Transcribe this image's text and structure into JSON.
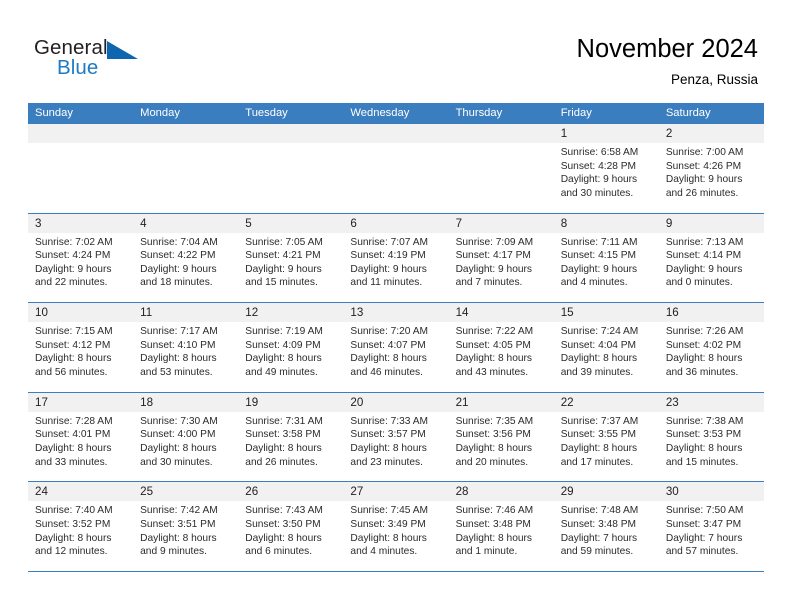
{
  "logo": {
    "word_one": "General",
    "word_two": "Blue",
    "mark": "triangle-mark"
  },
  "header": {
    "title": "November 2024",
    "location": "Penza, Russia"
  },
  "weekdays": [
    "Sunday",
    "Monday",
    "Tuesday",
    "Wednesday",
    "Thursday",
    "Friday",
    "Saturday"
  ],
  "colors": {
    "header_blue": "#3b7ebf",
    "logo_blue": "#1f7ac4",
    "day_band": "#f1f1f1",
    "text": "#2b2b2b"
  },
  "weeks": [
    [
      {
        "day": "",
        "lines": []
      },
      {
        "day": "",
        "lines": []
      },
      {
        "day": "",
        "lines": []
      },
      {
        "day": "",
        "lines": []
      },
      {
        "day": "",
        "lines": []
      },
      {
        "day": "1",
        "lines": [
          "Sunrise: 6:58 AM",
          "Sunset: 4:28 PM",
          "Daylight: 9 hours",
          "and 30 minutes."
        ]
      },
      {
        "day": "2",
        "lines": [
          "Sunrise: 7:00 AM",
          "Sunset: 4:26 PM",
          "Daylight: 9 hours",
          "and 26 minutes."
        ]
      }
    ],
    [
      {
        "day": "3",
        "lines": [
          "Sunrise: 7:02 AM",
          "Sunset: 4:24 PM",
          "Daylight: 9 hours",
          "and 22 minutes."
        ]
      },
      {
        "day": "4",
        "lines": [
          "Sunrise: 7:04 AM",
          "Sunset: 4:22 PM",
          "Daylight: 9 hours",
          "and 18 minutes."
        ]
      },
      {
        "day": "5",
        "lines": [
          "Sunrise: 7:05 AM",
          "Sunset: 4:21 PM",
          "Daylight: 9 hours",
          "and 15 minutes."
        ]
      },
      {
        "day": "6",
        "lines": [
          "Sunrise: 7:07 AM",
          "Sunset: 4:19 PM",
          "Daylight: 9 hours",
          "and 11 minutes."
        ]
      },
      {
        "day": "7",
        "lines": [
          "Sunrise: 7:09 AM",
          "Sunset: 4:17 PM",
          "Daylight: 9 hours",
          "and 7 minutes."
        ]
      },
      {
        "day": "8",
        "lines": [
          "Sunrise: 7:11 AM",
          "Sunset: 4:15 PM",
          "Daylight: 9 hours",
          "and 4 minutes."
        ]
      },
      {
        "day": "9",
        "lines": [
          "Sunrise: 7:13 AM",
          "Sunset: 4:14 PM",
          "Daylight: 9 hours",
          "and 0 minutes."
        ]
      }
    ],
    [
      {
        "day": "10",
        "lines": [
          "Sunrise: 7:15 AM",
          "Sunset: 4:12 PM",
          "Daylight: 8 hours",
          "and 56 minutes."
        ]
      },
      {
        "day": "11",
        "lines": [
          "Sunrise: 7:17 AM",
          "Sunset: 4:10 PM",
          "Daylight: 8 hours",
          "and 53 minutes."
        ]
      },
      {
        "day": "12",
        "lines": [
          "Sunrise: 7:19 AM",
          "Sunset: 4:09 PM",
          "Daylight: 8 hours",
          "and 49 minutes."
        ]
      },
      {
        "day": "13",
        "lines": [
          "Sunrise: 7:20 AM",
          "Sunset: 4:07 PM",
          "Daylight: 8 hours",
          "and 46 minutes."
        ]
      },
      {
        "day": "14",
        "lines": [
          "Sunrise: 7:22 AM",
          "Sunset: 4:05 PM",
          "Daylight: 8 hours",
          "and 43 minutes."
        ]
      },
      {
        "day": "15",
        "lines": [
          "Sunrise: 7:24 AM",
          "Sunset: 4:04 PM",
          "Daylight: 8 hours",
          "and 39 minutes."
        ]
      },
      {
        "day": "16",
        "lines": [
          "Sunrise: 7:26 AM",
          "Sunset: 4:02 PM",
          "Daylight: 8 hours",
          "and 36 minutes."
        ]
      }
    ],
    [
      {
        "day": "17",
        "lines": [
          "Sunrise: 7:28 AM",
          "Sunset: 4:01 PM",
          "Daylight: 8 hours",
          "and 33 minutes."
        ]
      },
      {
        "day": "18",
        "lines": [
          "Sunrise: 7:30 AM",
          "Sunset: 4:00 PM",
          "Daylight: 8 hours",
          "and 30 minutes."
        ]
      },
      {
        "day": "19",
        "lines": [
          "Sunrise: 7:31 AM",
          "Sunset: 3:58 PM",
          "Daylight: 8 hours",
          "and 26 minutes."
        ]
      },
      {
        "day": "20",
        "lines": [
          "Sunrise: 7:33 AM",
          "Sunset: 3:57 PM",
          "Daylight: 8 hours",
          "and 23 minutes."
        ]
      },
      {
        "day": "21",
        "lines": [
          "Sunrise: 7:35 AM",
          "Sunset: 3:56 PM",
          "Daylight: 8 hours",
          "and 20 minutes."
        ]
      },
      {
        "day": "22",
        "lines": [
          "Sunrise: 7:37 AM",
          "Sunset: 3:55 PM",
          "Daylight: 8 hours",
          "and 17 minutes."
        ]
      },
      {
        "day": "23",
        "lines": [
          "Sunrise: 7:38 AM",
          "Sunset: 3:53 PM",
          "Daylight: 8 hours",
          "and 15 minutes."
        ]
      }
    ],
    [
      {
        "day": "24",
        "lines": [
          "Sunrise: 7:40 AM",
          "Sunset: 3:52 PM",
          "Daylight: 8 hours",
          "and 12 minutes."
        ]
      },
      {
        "day": "25",
        "lines": [
          "Sunrise: 7:42 AM",
          "Sunset: 3:51 PM",
          "Daylight: 8 hours",
          "and 9 minutes."
        ]
      },
      {
        "day": "26",
        "lines": [
          "Sunrise: 7:43 AM",
          "Sunset: 3:50 PM",
          "Daylight: 8 hours",
          "and 6 minutes."
        ]
      },
      {
        "day": "27",
        "lines": [
          "Sunrise: 7:45 AM",
          "Sunset: 3:49 PM",
          "Daylight: 8 hours",
          "and 4 minutes."
        ]
      },
      {
        "day": "28",
        "lines": [
          "Sunrise: 7:46 AM",
          "Sunset: 3:48 PM",
          "Daylight: 8 hours",
          "and 1 minute."
        ]
      },
      {
        "day": "29",
        "lines": [
          "Sunrise: 7:48 AM",
          "Sunset: 3:48 PM",
          "Daylight: 7 hours",
          "and 59 minutes."
        ]
      },
      {
        "day": "30",
        "lines": [
          "Sunrise: 7:50 AM",
          "Sunset: 3:47 PM",
          "Daylight: 7 hours",
          "and 57 minutes."
        ]
      }
    ]
  ]
}
